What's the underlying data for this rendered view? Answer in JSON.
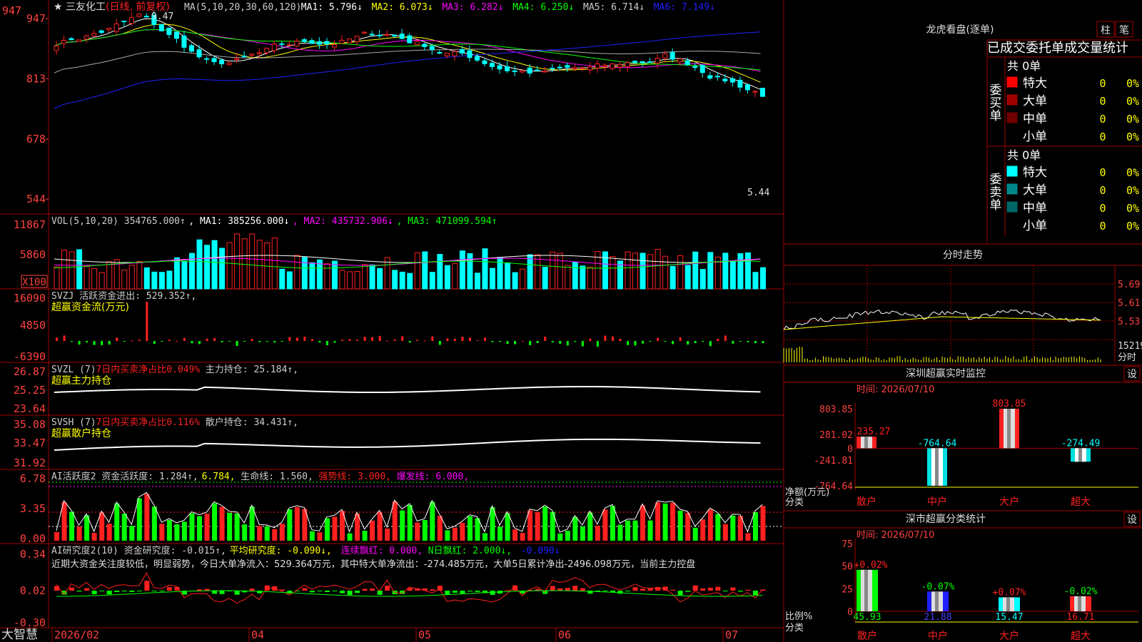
{
  "app": {
    "name": "大智慧",
    "stock_name": "三友化工",
    "adjust_label": "日线, 前复权"
  },
  "colors": {
    "bg": "#000000",
    "up": "#ff2020",
    "down": "#00ffff",
    "grid": "#a00000",
    "axis_text": "#ff4040",
    "white": "#ffffff",
    "yellow": "#ffff00",
    "magenta": "#ff00ff",
    "green": "#00ff00",
    "blue": "#2020ff"
  },
  "kline": {
    "header": [
      {
        "text": "MA(5,10,20,30,60,120)",
        "color": "#cccccc"
      },
      {
        "text": " MA1: 5.796↓",
        "color": "#ffffff"
      },
      {
        "text": " MA2: 6.073↓",
        "color": "#ffff00"
      },
      {
        "text": " MA3: 6.282↓",
        "color": "#ff00ff"
      },
      {
        "text": " MA4: 6.250↓",
        "color": "#00ff00"
      },
      {
        "text": " MA5: 6.714↓",
        "color": "#cccccc"
      },
      {
        "text": " MA6: 7.149↓",
        "color": "#2020ff"
      }
    ],
    "y_ticks": [
      "947",
      "813",
      "678",
      "544"
    ],
    "high_label": "9.47",
    "low_label": "5.44"
  },
  "vol": {
    "header": [
      {
        "text": "VOL(5,10,20) 354765.000↑",
        "color": "#cccccc"
      },
      {
        "text": ", MA1: 385256.000↓",
        "color": "#ffffff"
      },
      {
        "text": ", MA2: 435732.906↓",
        "color": "#ff00ff"
      },
      {
        "text": ", MA3: 471099.594↑",
        "color": "#00ff00"
      }
    ],
    "y_ticks": [
      "11867",
      "5860"
    ],
    "unit_label": "X100"
  },
  "svzj": {
    "header": [
      {
        "text": "SVZJ  活跃资金进出: 529.352↑,",
        "color": "#cccccc"
      }
    ],
    "subtitle": "超赢资金流(万元)",
    "y_ticks": [
      "16090",
      "4850",
      "-6390"
    ]
  },
  "svzl": {
    "header": [
      {
        "text": "SVZL (7)",
        "color": "#cccccc"
      },
      {
        "text": " 7日内买卖净占比0.049%",
        "color": "#ff2020"
      },
      {
        "text": " 主力持仓: 25.184↑,",
        "color": "#cccccc"
      }
    ],
    "subtitle": "超赢主力持仓",
    "y_ticks": [
      "26.87",
      "25.25",
      "23.64"
    ]
  },
  "svsh": {
    "header": [
      {
        "text": "SVSH (7)",
        "color": "#cccccc"
      },
      {
        "text": " 7日内买卖净占比0.116%",
        "color": "#ff2020"
      },
      {
        "text": " 散户持仓: 34.431↑,",
        "color": "#cccccc"
      }
    ],
    "subtitle": "超赢散户持仓",
    "y_ticks": [
      "35.08",
      "33.47",
      "31.92"
    ]
  },
  "ai_active": {
    "header": [
      {
        "text": "AI活跃度2 资金活跃度: 1.284↑,",
        "color": "#cccccc"
      },
      {
        "text": " 6.784,",
        "color": "#ffff00"
      },
      {
        "text": " 生命线: 1.560,",
        "color": "#cccccc"
      },
      {
        "text": " 强势线: 3.000,",
        "color": "#ff2020"
      },
      {
        "text": " 爆发线: 6.000,",
        "color": "#ff00ff"
      }
    ],
    "y_ticks": [
      "6.78",
      "3.35",
      "0.00"
    ]
  },
  "ai_research": {
    "header": [
      {
        "text": "AI研究度2(10) 资金研究度: -0.015↑,",
        "color": "#cccccc"
      },
      {
        "text": " 平均研究度: -0.090↓,",
        "color": "#ffff00"
      },
      {
        "text": " 连续飘红: 0.000,",
        "color": "#ff00ff"
      },
      {
        "text": " N日飘红: 2.000↓,",
        "color": "#00ff00"
      },
      {
        "text": " -0.090↓",
        "color": "#2020ff"
      }
    ],
    "commentary": "近期大资金关注度较低，明显弱势，今日大单净流入：529.364万元，其中特大单净流出：-274.485万元，大单5日累计净出-2496.098万元，当前主力控盘",
    "y_ticks": [
      "0.34",
      "0.02",
      "-0.30"
    ]
  },
  "x_axis": [
    "2026/02",
    "04",
    "05",
    "06",
    "07"
  ],
  "right": {
    "dragon": {
      "title": "龙虎看盘(逐单)",
      "btn1": "柱",
      "btn2": "笔",
      "subtitle": "已成交委托单成交量统计"
    },
    "buy": {
      "total": "共 0单",
      "label": "委买单",
      "rows": [
        {
          "name": "特大",
          "count": "0",
          "pct": "0%",
          "color": "#ff0000"
        },
        {
          "name": "大单",
          "count": "0",
          "pct": "0%",
          "color": "#a00000"
        },
        {
          "name": "中单",
          "count": "0",
          "pct": "0%",
          "color": "#700000"
        },
        {
          "name": "小单",
          "count": "0",
          "pct": "0%",
          "color": "#000000"
        }
      ]
    },
    "sell": {
      "total": "共 0单",
      "label": "委卖单",
      "rows": [
        {
          "name": "特大",
          "count": "0",
          "pct": "0%",
          "color": "#00ffff"
        },
        {
          "name": "大单",
          "count": "0",
          "pct": "0%",
          "color": "#008888"
        },
        {
          "name": "中单",
          "count": "0",
          "pct": "0%",
          "color": "#006666"
        },
        {
          "name": "小单",
          "count": "0",
          "pct": "0%",
          "color": "#000000"
        }
      ]
    },
    "intraday": {
      "title": "分时走势",
      "y_ticks": [
        "5.69",
        "5.61",
        "5.53"
      ],
      "vol_label": "15219",
      "vol_unit": "分时"
    },
    "monitor": {
      "title": "深圳超赢实时监控",
      "set_btn": "设",
      "time": "时间: 2026/07/10",
      "y_ticks": [
        "803.85",
        "281.02",
        "0",
        "-241.81",
        "-764.64"
      ],
      "y_label": "净额(万元)",
      "x_label": "分类",
      "categories": [
        "散户",
        "中户",
        "大户",
        "超大"
      ],
      "values": [
        235.27,
        -764.64,
        803.85,
        -274.49
      ],
      "value_labels": [
        "235.27",
        "-764.64",
        "803.85",
        "-274.49"
      ]
    },
    "classify": {
      "title": "深市超赢分类统计",
      "set_btn": "设",
      "time": "时间: 2026/07/10",
      "y_ticks": [
        "75",
        "50",
        "25",
        "0"
      ],
      "y_label": "比例%",
      "x_label": "分类",
      "categories": [
        "散户",
        "中户",
        "大户",
        "超大"
      ],
      "values": [
        45.93,
        21.88,
        15.47,
        16.71
      ],
      "changes": [
        "+0.02%",
        "-0.07%",
        "+0.07%",
        "-0.02%"
      ],
      "colors": [
        "#00ff00",
        "#2020ff",
        "#00ffff",
        "#ff2020"
      ]
    }
  },
  "chart_data": [
    {
      "type": "bar",
      "title": "深圳超赢实时监控",
      "ylabel": "净额(万元)",
      "xlabel": "分类",
      "categories": [
        "散户",
        "中户",
        "大户",
        "超大"
      ],
      "values": [
        235.27,
        -764.64,
        803.85,
        -274.49
      ],
      "ylim": [
        -764.64,
        803.85
      ]
    },
    {
      "type": "bar",
      "title": "深市超赢分类统计",
      "ylabel": "比例%",
      "xlabel": "分类",
      "categories": [
        "散户",
        "中户",
        "大户",
        "超大"
      ],
      "values": [
        45.93,
        21.88,
        15.47,
        16.71
      ],
      "ylim": [
        0,
        75
      ]
    }
  ]
}
